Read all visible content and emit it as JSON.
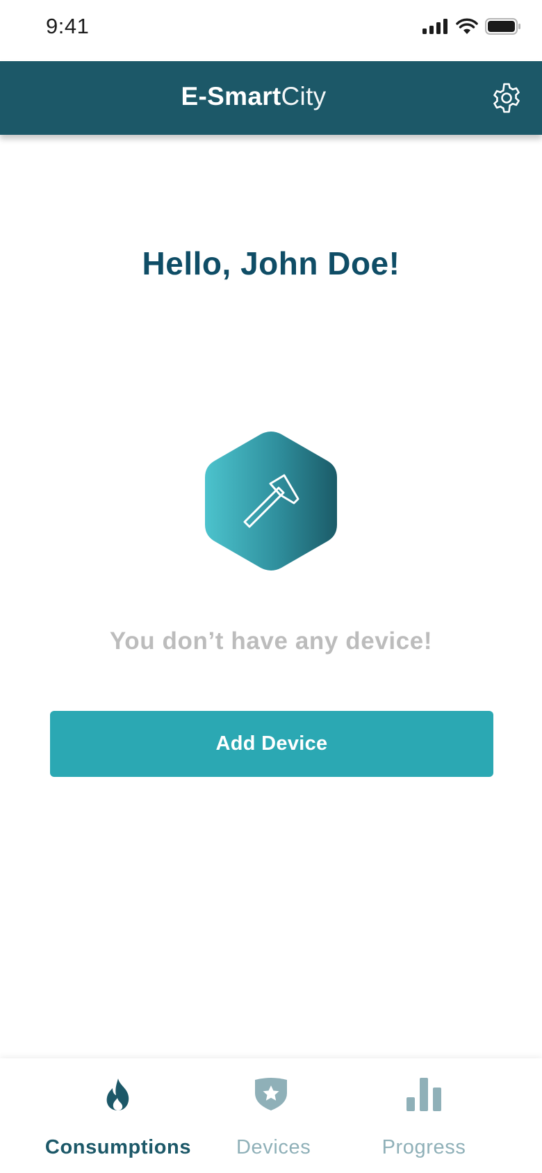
{
  "status_bar": {
    "time": "9:41"
  },
  "header": {
    "title_bold": "E-Smart",
    "title_light": "City",
    "settings_icon": "gear-icon"
  },
  "main": {
    "greeting": "Hello, John Doe!",
    "empty_icon": "hammer-icon",
    "empty_message": "You don’t have any device!",
    "add_device_label": "Add Device"
  },
  "bottom_nav": {
    "items": [
      {
        "label": "Consumptions",
        "icon": "flame-icon",
        "active": true
      },
      {
        "label": "Devices",
        "icon": "shield-star-icon",
        "active": false
      },
      {
        "label": "Progress",
        "icon": "bar-chart-icon",
        "active": false
      }
    ]
  },
  "colors": {
    "header_bg": "#1c5868",
    "accent": "#2ba8b3",
    "greeting": "#0f4d66",
    "muted_text": "#bcbcbc",
    "nav_inactive": "#8fb0b8"
  }
}
